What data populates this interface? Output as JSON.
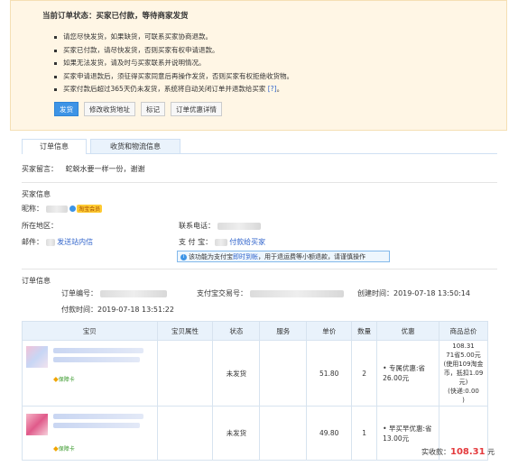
{
  "status_panel": {
    "title": "当前订单状态：买家已付款，等待商家发货",
    "notices": [
      "请您尽快发货，如果缺货，可联系买家协商退款。",
      "买家已付款，请尽快发货，否则买家有权申请退款。",
      "如果无法发货，请及时与买家联系并说明情况。",
      "买家申请退款后，须征得买家同意后再操作发货，否则买家有权拒绝收货物。",
      "买家付款后超过365天仍未发货，系统将自动关闭订单并退款给买家"
    ],
    "notice_help_link": "[?]",
    "notice_tail": "。",
    "buttons": {
      "ship": "发货",
      "edit_address": "修改收货地址",
      "mark": "标记",
      "discount_detail": "订单优惠详情"
    }
  },
  "tabs": [
    "订单信息",
    "收货和物流信息"
  ],
  "buyer_message": {
    "label": "买家留言：",
    "value": "蛇蜕水要一样一份，谢谢"
  },
  "buyer_info": {
    "section_title": "买家信息",
    "nickname_label": "昵称：",
    "badge": "淘宝会员",
    "location_label": "所在地区：",
    "phone_label": "联系电话：",
    "email_label": "邮件：",
    "send_mail_link": "发送站内信",
    "alipay_label": "支 付 宝：",
    "pay_buyer_link": "付款给买家",
    "notice_prefix": "该功能为支付宝",
    "notice_link": "即时到帐",
    "notice_suffix": "，用于退运费等小额退款，请谨慎操作"
  },
  "order_info": {
    "section_title": "订单信息",
    "order_no_label": "订单编号：",
    "alipay_trade_label": "支付宝交易号：",
    "created_label": "创建时间：",
    "created_time": "2019-07-18 13:50:14",
    "paid_label": "付款时间：",
    "paid_time": "2019-07-18 13:51:22"
  },
  "table": {
    "headers": [
      "宝贝",
      "宝贝属性",
      "状态",
      "服务",
      "单价",
      "数量",
      "优惠",
      "商品总价"
    ],
    "protect_label": "保障卡",
    "rows": [
      {
        "status": "未发货",
        "price": "51.80",
        "qty": "2",
        "discount": "专属优惠:省26.00元",
        "total_lines": [
          "108.31",
          "71省5.00元",
          "(使用109淘金",
          "币，抵扣1.09",
          "元)",
          "(快递:0.00",
          ")"
        ]
      },
      {
        "status": "未发货",
        "price": "49.80",
        "qty": "1",
        "discount": "早买早优惠:省13.00元",
        "total_lines": []
      }
    ]
  },
  "footer": {
    "label": "实收款：",
    "amount": "108.31",
    "unit": "元"
  }
}
